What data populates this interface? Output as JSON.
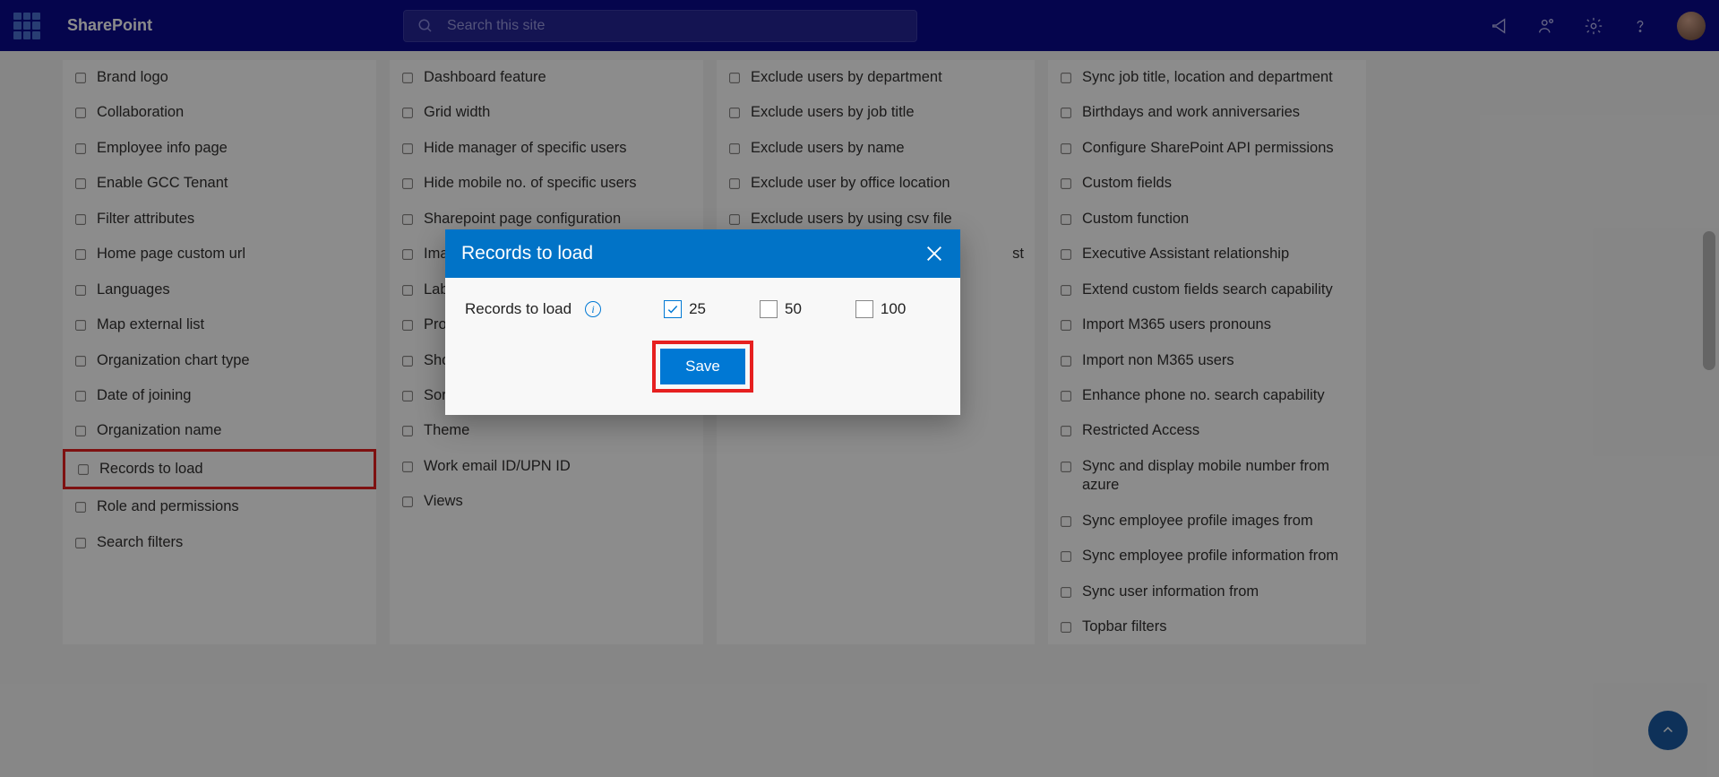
{
  "header": {
    "brand": "SharePoint",
    "search_placeholder": "Search this site"
  },
  "columns": [
    [
      {
        "icon": "badge",
        "label": "Brand logo"
      },
      {
        "icon": "collab",
        "label": "Collaboration"
      },
      {
        "icon": "page",
        "label": "Employee info page"
      },
      {
        "icon": "globe",
        "label": "Enable GCC Tenant"
      },
      {
        "icon": "gear",
        "label": "Filter attributes"
      },
      {
        "icon": "home",
        "label": "Home page custom url"
      },
      {
        "icon": "lang",
        "label": "Languages"
      },
      {
        "icon": "list",
        "label": "Map external list"
      },
      {
        "icon": "chart",
        "label": "Organization chart type"
      },
      {
        "icon": "calendar",
        "label": "Date of joining"
      },
      {
        "icon": "org",
        "label": "Organization name"
      },
      {
        "icon": "records",
        "label": "Records to load",
        "highlighted": true
      },
      {
        "icon": "badge",
        "label": "Role and permissions"
      },
      {
        "icon": "search",
        "label": "Search filters"
      }
    ],
    [
      {
        "icon": "dash",
        "label": "Dashboard feature"
      },
      {
        "icon": "grid",
        "label": "Grid width"
      },
      {
        "icon": "hide",
        "label": "Hide manager of specific users"
      },
      {
        "icon": "hide",
        "label": "Hide mobile no. of specific users"
      },
      {
        "icon": "hide",
        "label": "Sharepoint page configuration"
      },
      {
        "icon": "person",
        "label": "Imag"
      },
      {
        "icon": "tag",
        "label": "Labe"
      },
      {
        "icon": "grid",
        "label": "Profi"
      },
      {
        "icon": "eye",
        "label": "Show"
      },
      {
        "icon": "sort",
        "label": "Sort"
      },
      {
        "icon": "paint",
        "label": "Theme"
      },
      {
        "icon": "mail",
        "label": "Work email ID/UPN ID"
      },
      {
        "icon": "eye",
        "label": "Views"
      }
    ],
    [
      {
        "icon": "doc",
        "label": "Exclude users by department"
      },
      {
        "icon": "brief",
        "label": "Exclude users by job title"
      },
      {
        "icon": "persons",
        "label": "Exclude users by name"
      },
      {
        "icon": "building",
        "label": "Exclude user by office location"
      },
      {
        "icon": "file",
        "label": "Exclude users by using csv file"
      },
      {
        "icon": "x",
        "label": "",
        "hidden": true
      },
      {
        "icon": "x",
        "label": "",
        "hidden": true
      },
      {
        "icon": "x",
        "label": "st",
        "hidden": false,
        "suffix": true
      }
    ],
    [
      {
        "icon": "sync",
        "label": "Sync job title, location and department"
      },
      {
        "icon": "cake",
        "label": "Birthdays and work anniversaries"
      },
      {
        "icon": "cloud",
        "label": "Configure SharePoint API permissions"
      },
      {
        "icon": "plus",
        "label": "Custom fields"
      },
      {
        "icon": "key",
        "label": "Custom function"
      },
      {
        "icon": "persons",
        "label": "Executive Assistant relationship"
      },
      {
        "icon": "search",
        "label": "Extend custom fields search capability"
      },
      {
        "icon": "chat",
        "label": "Import M365 users pronouns"
      },
      {
        "icon": "import",
        "label": "Import non M365 users"
      },
      {
        "icon": "key",
        "label": "Enhance phone no. search capability"
      },
      {
        "icon": "lock",
        "label": "Restricted Access"
      },
      {
        "icon": "sync",
        "label": "Sync and display mobile number from azure"
      },
      {
        "icon": "sync",
        "label": "Sync employee profile images from"
      },
      {
        "icon": "sync",
        "label": "Sync employee profile information from"
      },
      {
        "icon": "person",
        "label": "Sync user information from"
      },
      {
        "icon": "filter",
        "label": "Topbar filters"
      }
    ]
  ],
  "modal": {
    "title": "Records to load",
    "field_label": "Records to load",
    "options": [
      {
        "value": "25",
        "checked": true
      },
      {
        "value": "50",
        "checked": false
      },
      {
        "value": "100",
        "checked": false
      }
    ],
    "save_label": "Save"
  }
}
